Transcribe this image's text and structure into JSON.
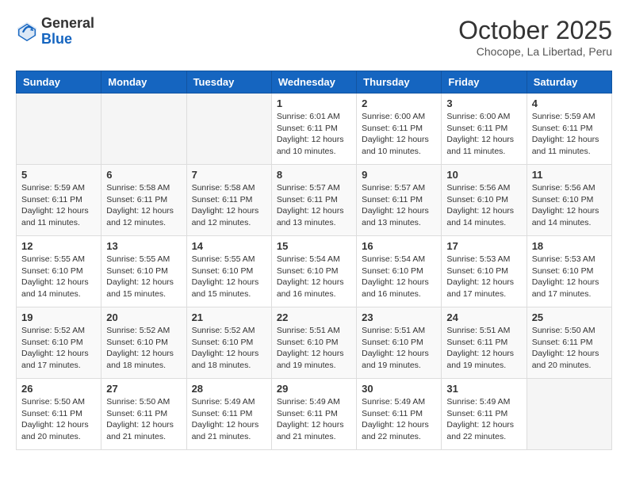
{
  "header": {
    "logo": {
      "line1": "General",
      "line2": "Blue"
    },
    "title": "October 2025",
    "location": "Chocope, La Libertad, Peru"
  },
  "weekdays": [
    "Sunday",
    "Monday",
    "Tuesday",
    "Wednesday",
    "Thursday",
    "Friday",
    "Saturday"
  ],
  "weeks": [
    [
      {
        "day": "",
        "info": ""
      },
      {
        "day": "",
        "info": ""
      },
      {
        "day": "",
        "info": ""
      },
      {
        "day": "1",
        "info": "Sunrise: 6:01 AM\nSunset: 6:11 PM\nDaylight: 12 hours\nand 10 minutes."
      },
      {
        "day": "2",
        "info": "Sunrise: 6:00 AM\nSunset: 6:11 PM\nDaylight: 12 hours\nand 10 minutes."
      },
      {
        "day": "3",
        "info": "Sunrise: 6:00 AM\nSunset: 6:11 PM\nDaylight: 12 hours\nand 11 minutes."
      },
      {
        "day": "4",
        "info": "Sunrise: 5:59 AM\nSunset: 6:11 PM\nDaylight: 12 hours\nand 11 minutes."
      }
    ],
    [
      {
        "day": "5",
        "info": "Sunrise: 5:59 AM\nSunset: 6:11 PM\nDaylight: 12 hours\nand 11 minutes."
      },
      {
        "day": "6",
        "info": "Sunrise: 5:58 AM\nSunset: 6:11 PM\nDaylight: 12 hours\nand 12 minutes."
      },
      {
        "day": "7",
        "info": "Sunrise: 5:58 AM\nSunset: 6:11 PM\nDaylight: 12 hours\nand 12 minutes."
      },
      {
        "day": "8",
        "info": "Sunrise: 5:57 AM\nSunset: 6:11 PM\nDaylight: 12 hours\nand 13 minutes."
      },
      {
        "day": "9",
        "info": "Sunrise: 5:57 AM\nSunset: 6:11 PM\nDaylight: 12 hours\nand 13 minutes."
      },
      {
        "day": "10",
        "info": "Sunrise: 5:56 AM\nSunset: 6:10 PM\nDaylight: 12 hours\nand 14 minutes."
      },
      {
        "day": "11",
        "info": "Sunrise: 5:56 AM\nSunset: 6:10 PM\nDaylight: 12 hours\nand 14 minutes."
      }
    ],
    [
      {
        "day": "12",
        "info": "Sunrise: 5:55 AM\nSunset: 6:10 PM\nDaylight: 12 hours\nand 14 minutes."
      },
      {
        "day": "13",
        "info": "Sunrise: 5:55 AM\nSunset: 6:10 PM\nDaylight: 12 hours\nand 15 minutes."
      },
      {
        "day": "14",
        "info": "Sunrise: 5:55 AM\nSunset: 6:10 PM\nDaylight: 12 hours\nand 15 minutes."
      },
      {
        "day": "15",
        "info": "Sunrise: 5:54 AM\nSunset: 6:10 PM\nDaylight: 12 hours\nand 16 minutes."
      },
      {
        "day": "16",
        "info": "Sunrise: 5:54 AM\nSunset: 6:10 PM\nDaylight: 12 hours\nand 16 minutes."
      },
      {
        "day": "17",
        "info": "Sunrise: 5:53 AM\nSunset: 6:10 PM\nDaylight: 12 hours\nand 17 minutes."
      },
      {
        "day": "18",
        "info": "Sunrise: 5:53 AM\nSunset: 6:10 PM\nDaylight: 12 hours\nand 17 minutes."
      }
    ],
    [
      {
        "day": "19",
        "info": "Sunrise: 5:52 AM\nSunset: 6:10 PM\nDaylight: 12 hours\nand 17 minutes."
      },
      {
        "day": "20",
        "info": "Sunrise: 5:52 AM\nSunset: 6:10 PM\nDaylight: 12 hours\nand 18 minutes."
      },
      {
        "day": "21",
        "info": "Sunrise: 5:52 AM\nSunset: 6:10 PM\nDaylight: 12 hours\nand 18 minutes."
      },
      {
        "day": "22",
        "info": "Sunrise: 5:51 AM\nSunset: 6:10 PM\nDaylight: 12 hours\nand 19 minutes."
      },
      {
        "day": "23",
        "info": "Sunrise: 5:51 AM\nSunset: 6:10 PM\nDaylight: 12 hours\nand 19 minutes."
      },
      {
        "day": "24",
        "info": "Sunrise: 5:51 AM\nSunset: 6:11 PM\nDaylight: 12 hours\nand 19 minutes."
      },
      {
        "day": "25",
        "info": "Sunrise: 5:50 AM\nSunset: 6:11 PM\nDaylight: 12 hours\nand 20 minutes."
      }
    ],
    [
      {
        "day": "26",
        "info": "Sunrise: 5:50 AM\nSunset: 6:11 PM\nDaylight: 12 hours\nand 20 minutes."
      },
      {
        "day": "27",
        "info": "Sunrise: 5:50 AM\nSunset: 6:11 PM\nDaylight: 12 hours\nand 21 minutes."
      },
      {
        "day": "28",
        "info": "Sunrise: 5:49 AM\nSunset: 6:11 PM\nDaylight: 12 hours\nand 21 minutes."
      },
      {
        "day": "29",
        "info": "Sunrise: 5:49 AM\nSunset: 6:11 PM\nDaylight: 12 hours\nand 21 minutes."
      },
      {
        "day": "30",
        "info": "Sunrise: 5:49 AM\nSunset: 6:11 PM\nDaylight: 12 hours\nand 22 minutes."
      },
      {
        "day": "31",
        "info": "Sunrise: 5:49 AM\nSunset: 6:11 PM\nDaylight: 12 hours\nand 22 minutes."
      },
      {
        "day": "",
        "info": ""
      }
    ]
  ]
}
